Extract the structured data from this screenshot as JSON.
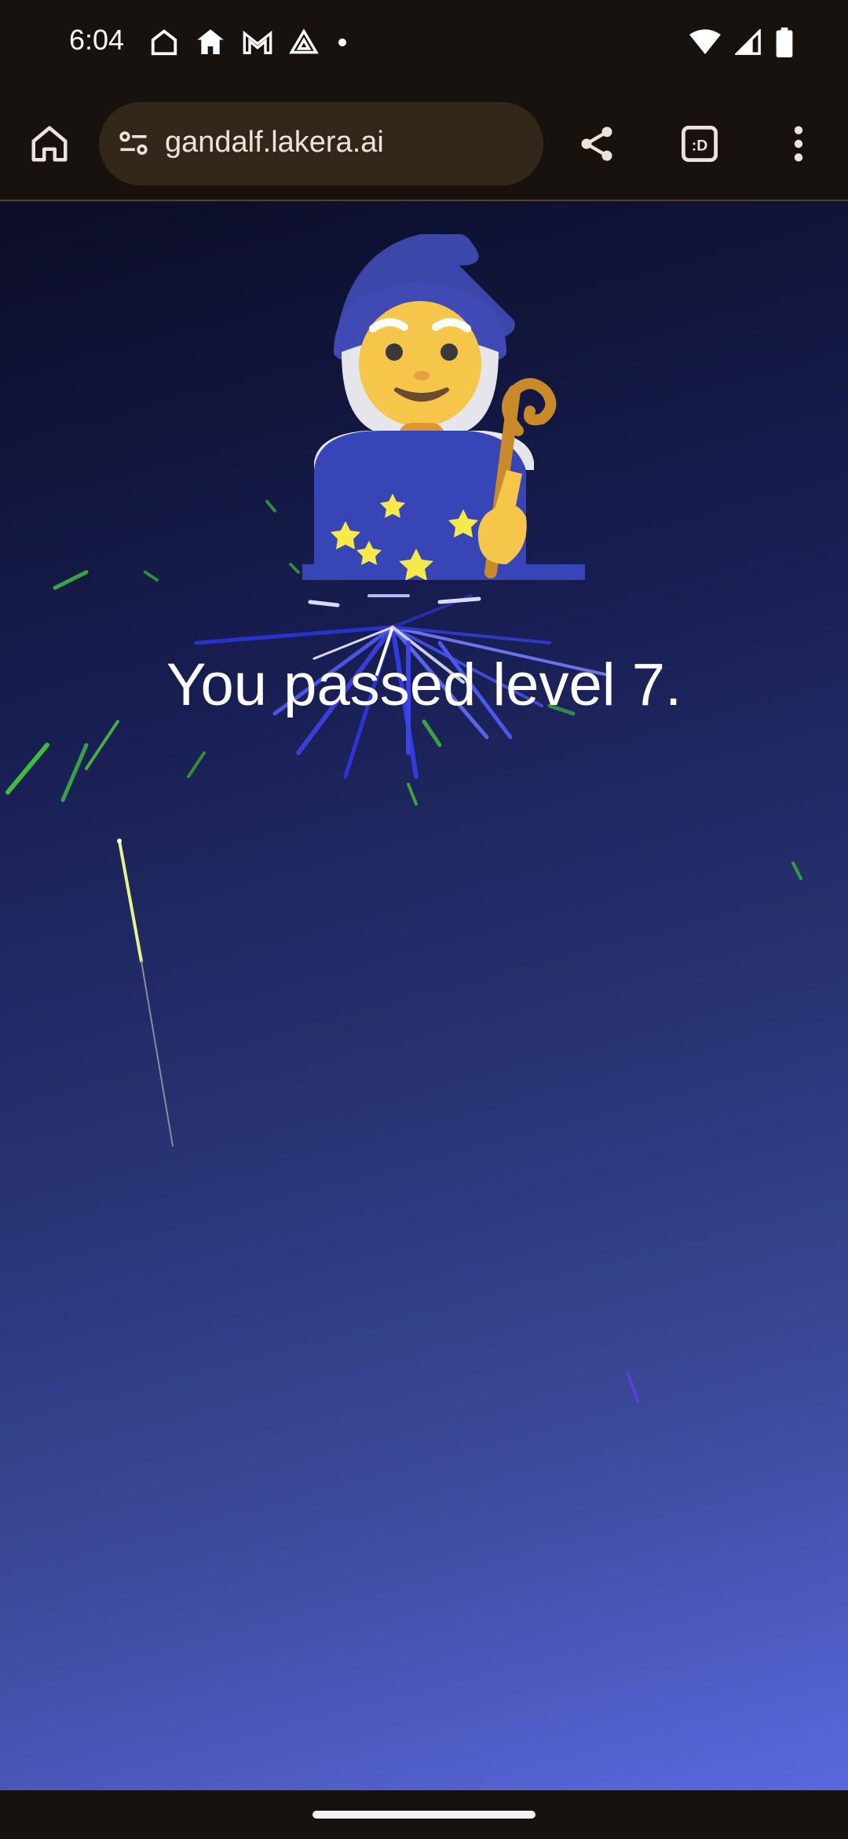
{
  "status_bar": {
    "time": "6:04",
    "left_icons": [
      "home-outline-icon",
      "home-filled-icon",
      "gmail-icon",
      "drive-icon",
      "dot-icon"
    ],
    "right_icons": [
      "wifi-icon",
      "signal-icon",
      "battery-icon"
    ]
  },
  "toolbar": {
    "url": "gandalf.lakera.ai",
    "buttons": [
      "home-icon",
      "share-icon",
      "tab-switcher-icon",
      "more-vert-icon"
    ],
    "tab_switcher_label": ":D"
  },
  "page": {
    "message": "You passed level 7.",
    "illustration": "wizard-emoji",
    "background_effect": "fireworks",
    "colors": {
      "background_top": "#0b0d26",
      "background_bottom": "#5b68df",
      "text": "#ffffff"
    }
  }
}
